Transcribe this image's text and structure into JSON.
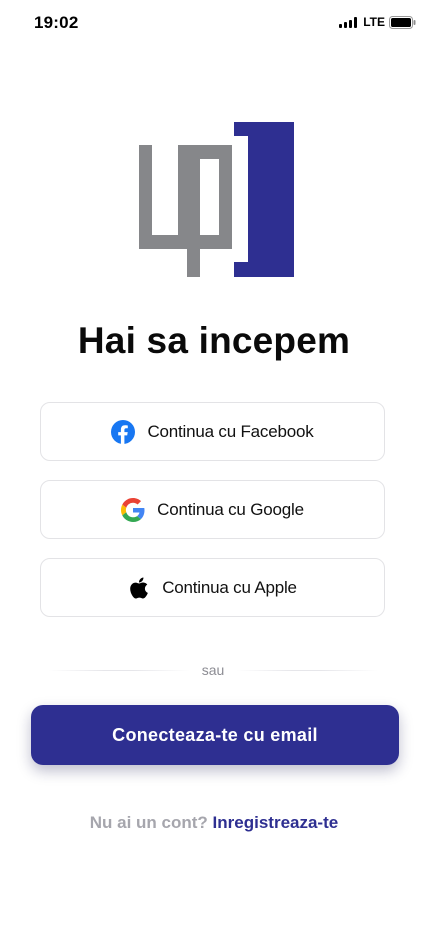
{
  "status_bar": {
    "time": "19:02",
    "network": "LTE",
    "icons": [
      "signal-icon",
      "battery-icon"
    ]
  },
  "logo": {
    "text": "up",
    "colors": {
      "letters": "#86878a",
      "bracket": "#2e2f91"
    }
  },
  "headline": "Hai sa incepem",
  "social_buttons": [
    {
      "label": "Continua cu Facebook",
      "icon": "facebook-icon"
    },
    {
      "label": "Continua cu Google",
      "icon": "google-icon"
    },
    {
      "label": "Continua cu Apple",
      "icon": "apple-icon"
    }
  ],
  "divider_text": "sau",
  "email_button": "Conecteaza-te cu email",
  "signup": {
    "prompt": "Nu ai un cont?",
    "link": "Inregistreaza-te"
  },
  "colors": {
    "primary": "#2e2f91",
    "muted": "#a6a6ad",
    "border": "#e3e3e6",
    "facebook": "#1877f2"
  }
}
